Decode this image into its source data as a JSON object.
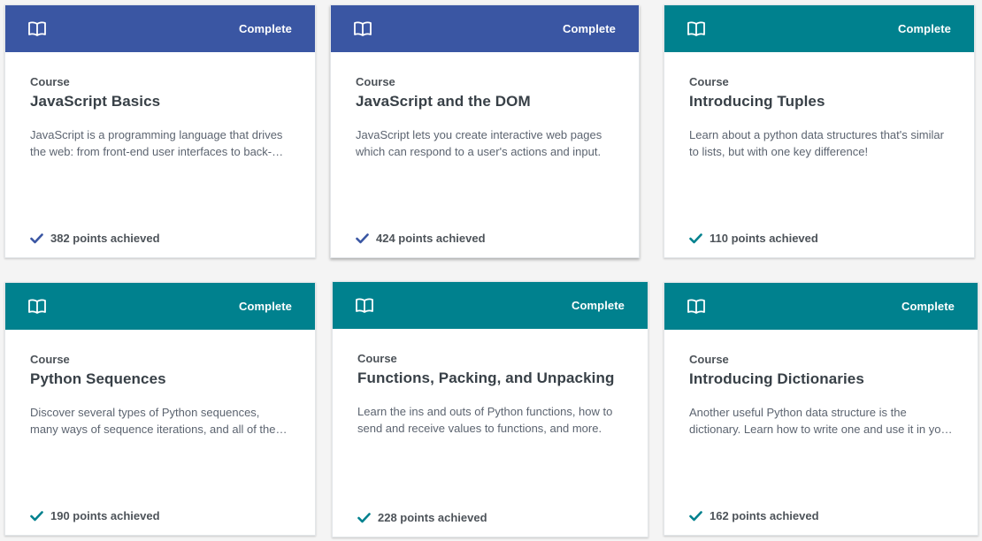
{
  "colors": {
    "blue_header": "#3a56a3",
    "teal_header": "#00818e",
    "blue_check": "#3a56a3",
    "teal_check": "#00818e"
  },
  "cards": [
    {
      "status": "Complete",
      "type": "Course",
      "title": "JavaScript Basics",
      "description": "JavaScript is a programming language that drives the web: from front-end user interfaces to back-end servers.",
      "points": "382 points achieved",
      "theme": "blue",
      "icon": "book-icon"
    },
    {
      "status": "Complete",
      "type": "Course",
      "title": "JavaScript and the DOM",
      "description": "JavaScript lets you create interactive web pages which can respond to a user's actions and input.",
      "points": "424 points achieved",
      "theme": "blue",
      "icon": "book-icon"
    },
    {
      "status": "Complete",
      "type": "Course",
      "title": "Introducing Tuples",
      "description": "Learn about a python data structures that's similar to lists, but with one key difference!",
      "points": "110 points achieved",
      "theme": "teal",
      "icon": "book-icon"
    },
    {
      "status": "Complete",
      "type": "Course",
      "title": "Python Sequences",
      "description": "Discover several types of Python sequences, many ways of sequence iterations, and all of the operations you can perform.",
      "points": "190 points achieved",
      "theme": "teal",
      "icon": "book-icon"
    },
    {
      "status": "Complete",
      "type": "Course",
      "title": "Functions, Packing, and Unpacking",
      "description": "Learn the ins and outs of Python functions, how to send and receive values to functions, and more.",
      "points": "228 points achieved",
      "theme": "teal",
      "icon": "book-icon"
    },
    {
      "status": "Complete",
      "type": "Course",
      "title": "Introducing Dictionaries",
      "description": "Another useful Python data structure is the dictionary. Learn how to write one and use it in your code.",
      "points": "162 points achieved",
      "theme": "teal",
      "icon": "book-icon"
    }
  ]
}
